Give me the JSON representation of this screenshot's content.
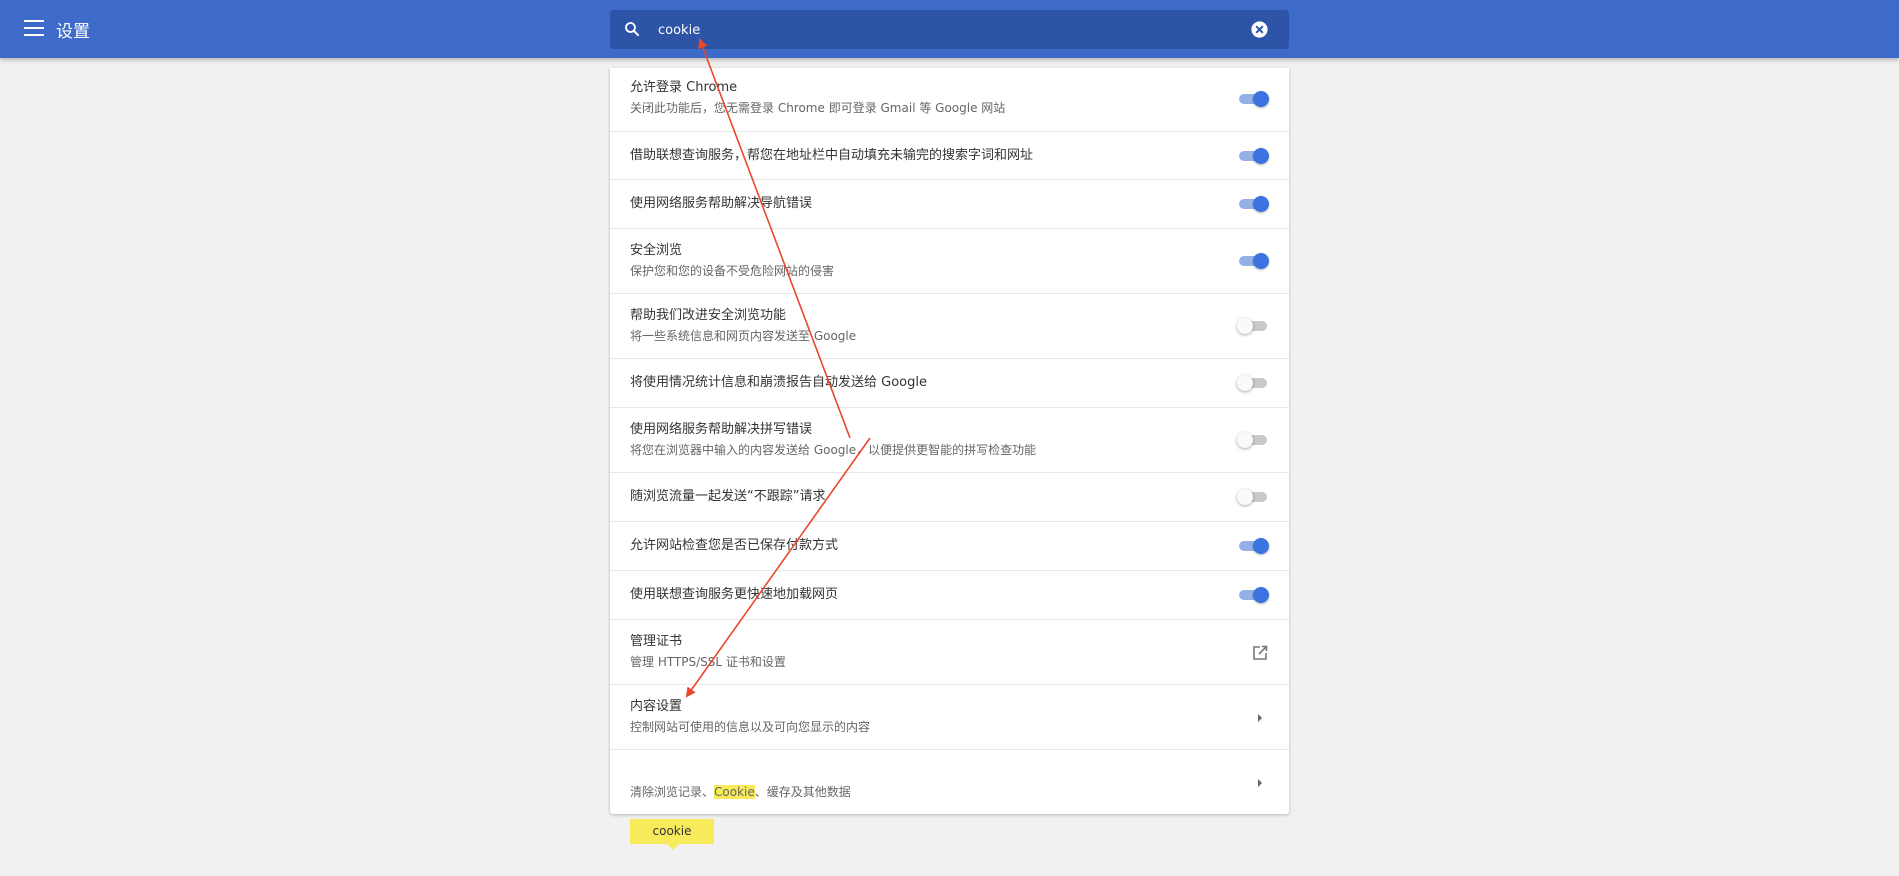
{
  "header": {
    "title": "设置"
  },
  "search": {
    "value": "cookie"
  },
  "settings": [
    {
      "label": "允许登录 Chrome",
      "sub": "关闭此功能后，您无需登录 Chrome 即可登录 Gmail 等 Google 网站",
      "control": "toggle",
      "on": true
    },
    {
      "label": "借助联想查询服务，帮您在地址栏中自动填充未输完的搜索字词和网址",
      "sub": "",
      "control": "toggle",
      "on": true
    },
    {
      "label": "使用网络服务帮助解决导航错误",
      "sub": "",
      "control": "toggle",
      "on": true
    },
    {
      "label": "安全浏览",
      "sub": "保护您和您的设备不受危险网站的侵害",
      "control": "toggle",
      "on": true
    },
    {
      "label": "帮助我们改进安全浏览功能",
      "sub": "将一些系统信息和网页内容发送至 Google",
      "control": "toggle",
      "on": false
    },
    {
      "label": "将使用情况统计信息和崩溃报告自动发送给 Google",
      "sub": "",
      "control": "toggle",
      "on": false
    },
    {
      "label": "使用网络服务帮助解决拼写错误",
      "sub": "将您在浏览器中输入的内容发送给 Google，以便提供更智能的拼写检查功能",
      "control": "toggle",
      "on": false
    },
    {
      "label": "随浏览流量一起发送“不跟踪”请求",
      "sub": "",
      "control": "toggle",
      "on": false
    },
    {
      "label": "允许网站检查您是否已保存付款方式",
      "sub": "",
      "control": "toggle",
      "on": true
    },
    {
      "label": "使用联想查询服务更快速地加载网页",
      "sub": "",
      "control": "toggle",
      "on": true
    },
    {
      "label": "管理证书",
      "sub": "管理 HTTPS/SSL 证书和设置",
      "control": "external-link-icon"
    },
    {
      "label": "内容设置",
      "sub": "控制网站可使用的信息以及可向您显示的内容",
      "control": "chevron-right-icon"
    }
  ],
  "clear_row": {
    "bubble": "cookie",
    "sub_before": "清除浏览记录、",
    "sub_highlight": "Cookie",
    "sub_after": "、缓存及其他数据",
    "control": "chevron-right-icon"
  },
  "colors": {
    "header": "#3e6ac9",
    "search_bg": "#2e54a7",
    "toggle_on": "#3b73e0",
    "highlight": "#f7ea5b",
    "annotation_arrow": "#e8482a"
  }
}
